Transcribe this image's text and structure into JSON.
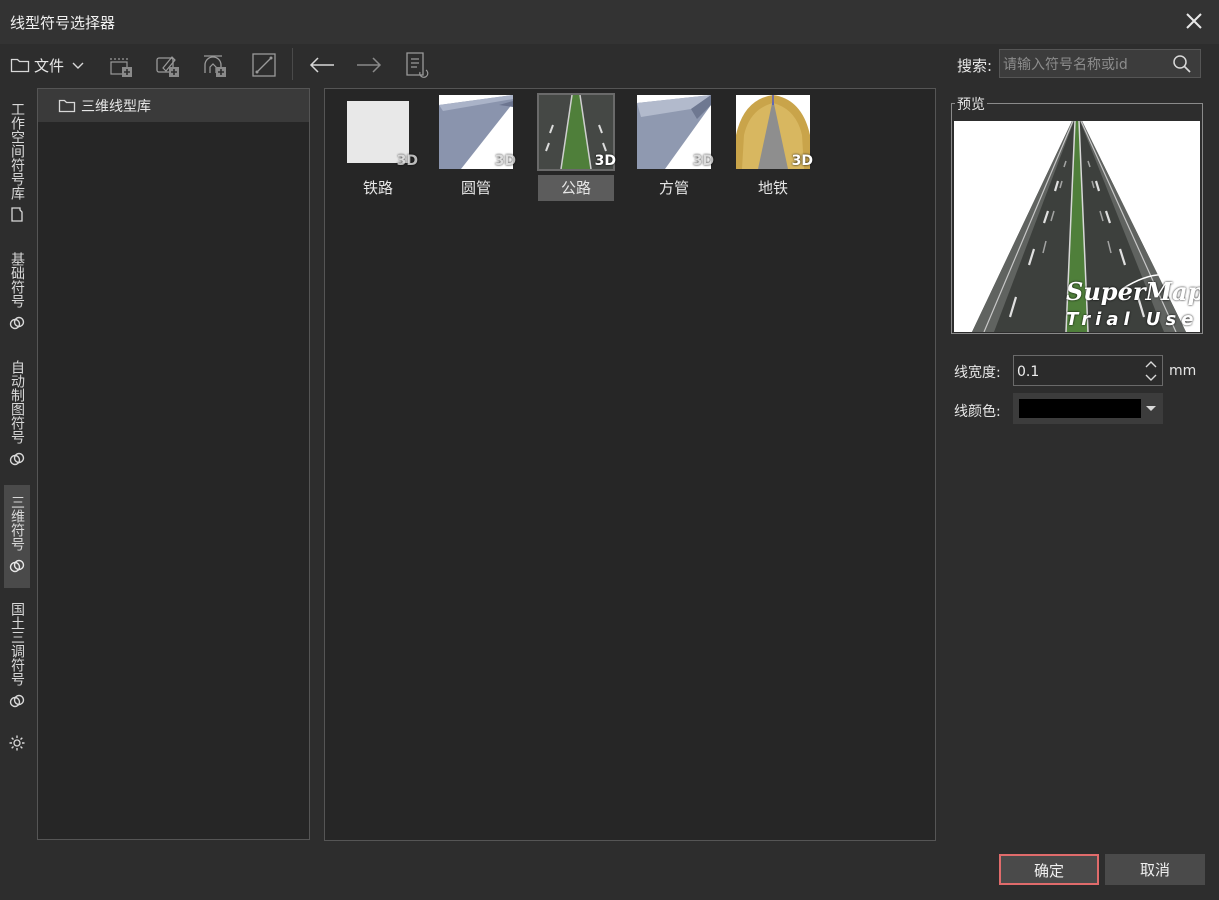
{
  "window": {
    "title": "线型符号选择器"
  },
  "toolbar": {
    "file_label": "文件",
    "buttons": [
      "new-symbol-icon",
      "edit-symbol-icon",
      "import-symbol-icon",
      "line-tool-icon",
      "arrow-left-icon",
      "arrow-right-icon",
      "document-icon"
    ]
  },
  "search": {
    "label": "搜索:",
    "placeholder": "请输入符号名称或id",
    "value": ""
  },
  "sidebar": {
    "tabs": [
      {
        "label": "工作空间符号库",
        "icon": "folder-icon",
        "active": false
      },
      {
        "label": "基础符号",
        "icon": "link-icon",
        "active": false
      },
      {
        "label": "自动制图符号",
        "icon": "link-icon",
        "active": false
      },
      {
        "label": "三维符号",
        "icon": "link-icon",
        "active": true
      },
      {
        "label": "国土三调符号",
        "icon": "link-icon",
        "active": false
      }
    ],
    "settings_icon": "gear-icon"
  },
  "tree": {
    "items": [
      {
        "label": "三维线型库",
        "icon": "folder-icon"
      }
    ]
  },
  "symbols": [
    {
      "label": "铁路",
      "badge": "3D",
      "selected": false
    },
    {
      "label": "圆管",
      "badge": "3D",
      "selected": false
    },
    {
      "label": "公路",
      "badge": "3D",
      "selected": true
    },
    {
      "label": "方管",
      "badge": "3D",
      "selected": false
    },
    {
      "label": "地铁",
      "badge": "3D",
      "selected": false
    }
  ],
  "preview": {
    "title": "预览",
    "watermark_brand": "SuperMap",
    "watermark_sub": "Trial Use"
  },
  "properties": {
    "width_label": "线宽度:",
    "width_value": "0.1",
    "width_unit": "mm",
    "color_label": "线颜色:",
    "color_value": "#000000"
  },
  "buttons": {
    "ok": "确定",
    "cancel": "取消"
  },
  "colors": {
    "ok_border": "#e06b6b",
    "selected_bg": "#5c5c5c",
    "background": "#2d2d2d"
  }
}
